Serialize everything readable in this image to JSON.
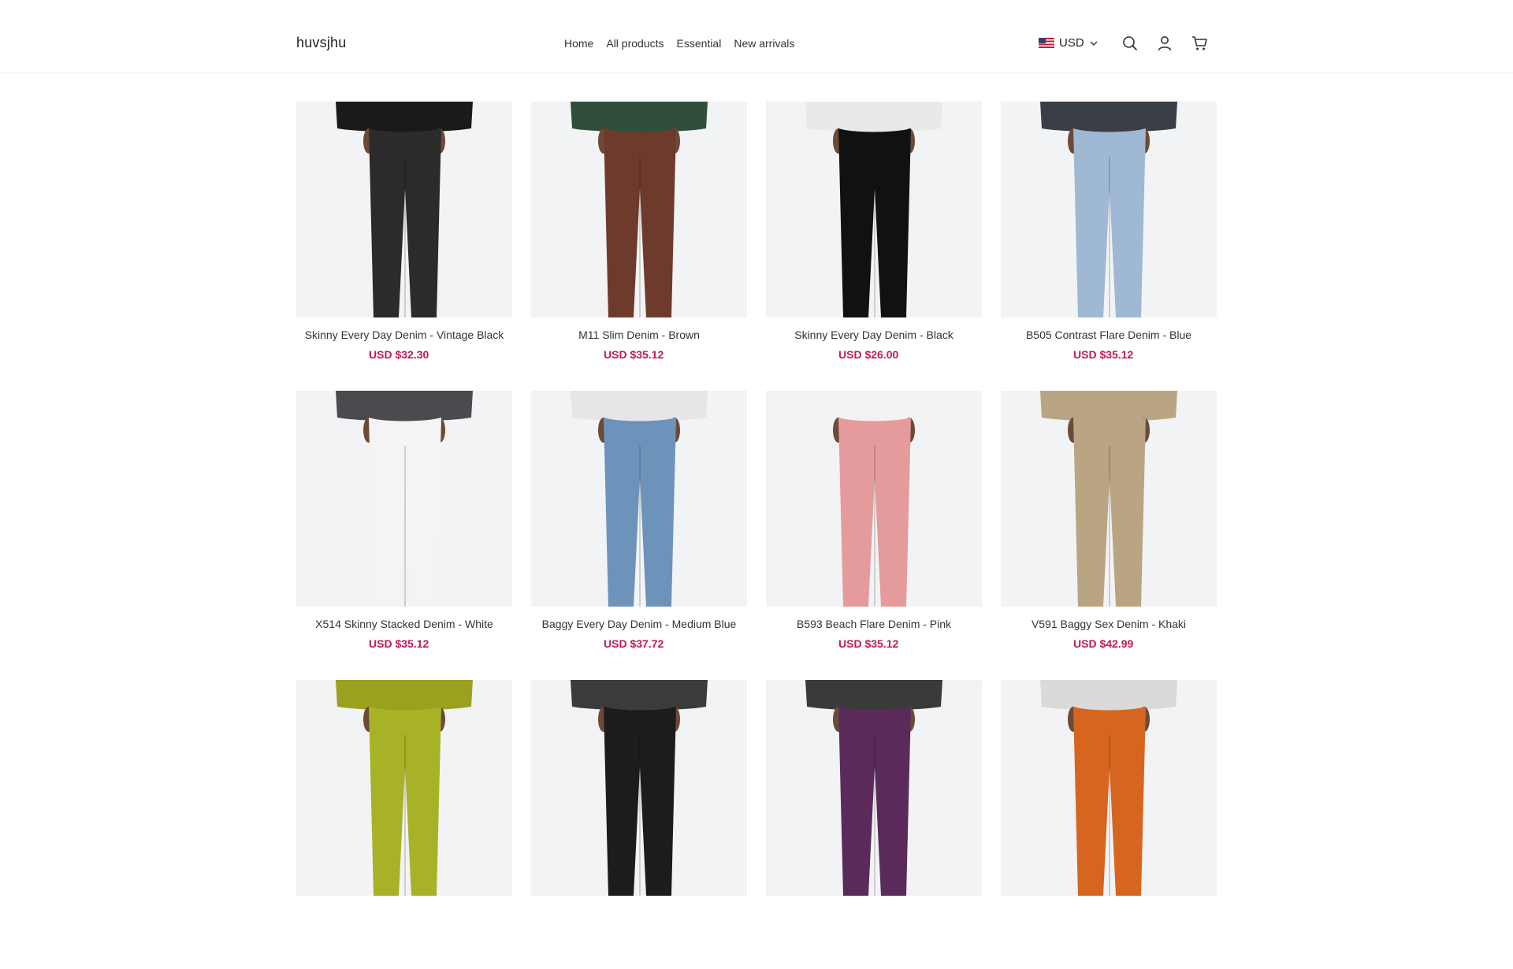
{
  "header": {
    "logo": "huvsjhu",
    "nav": [
      "Home",
      "All products",
      "Essential",
      "New arrivals"
    ],
    "currency": "USD"
  },
  "products": [
    {
      "name": "Skinny Every Day Denim - Vintage Black",
      "price": "USD $32.30",
      "pants": "#2b2b2b",
      "top": "#1a1a1a"
    },
    {
      "name": "M11 Slim Denim - Brown",
      "price": "USD $35.12",
      "pants": "#6e3a2c",
      "top": "#2f4f3a"
    },
    {
      "name": "Skinny Every Day Denim - Black",
      "price": "USD $26.00",
      "pants": "#111111",
      "top": "#e9e9e9"
    },
    {
      "name": "B505 Contrast Flare Denim - Blue",
      "price": "USD $35.12",
      "pants": "#9fb8d3",
      "top": "#3a3f47"
    },
    {
      "name": "X514 Skinny Stacked Denim - White",
      "price": "USD $35.12",
      "pants": "#f4f4f4",
      "top": "#4a4b4f"
    },
    {
      "name": "Baggy Every Day Denim - Medium Blue",
      "price": "USD $37.72",
      "pants": "#6d93bb",
      "top": "#e6e6e6"
    },
    {
      "name": "B593 Beach Flare Denim - Pink",
      "price": "USD $35.12",
      "pants": "#e59a9b",
      "top": "#f2f2f2"
    },
    {
      "name": "V591 Baggy Sex Denim - Khaki",
      "price": "USD $42.99",
      "pants": "#b9a583",
      "top": "#b9a583"
    },
    {
      "name": "",
      "price": "",
      "pants": "#a8b226",
      "top": "#9aa11f"
    },
    {
      "name": "",
      "price": "",
      "pants": "#1c1c1c",
      "top": "#3b3b3b"
    },
    {
      "name": "",
      "price": "",
      "pants": "#5a2b5a",
      "top": "#3a3a3a"
    },
    {
      "name": "",
      "price": "",
      "pants": "#d6661f",
      "top": "#dadada"
    }
  ]
}
